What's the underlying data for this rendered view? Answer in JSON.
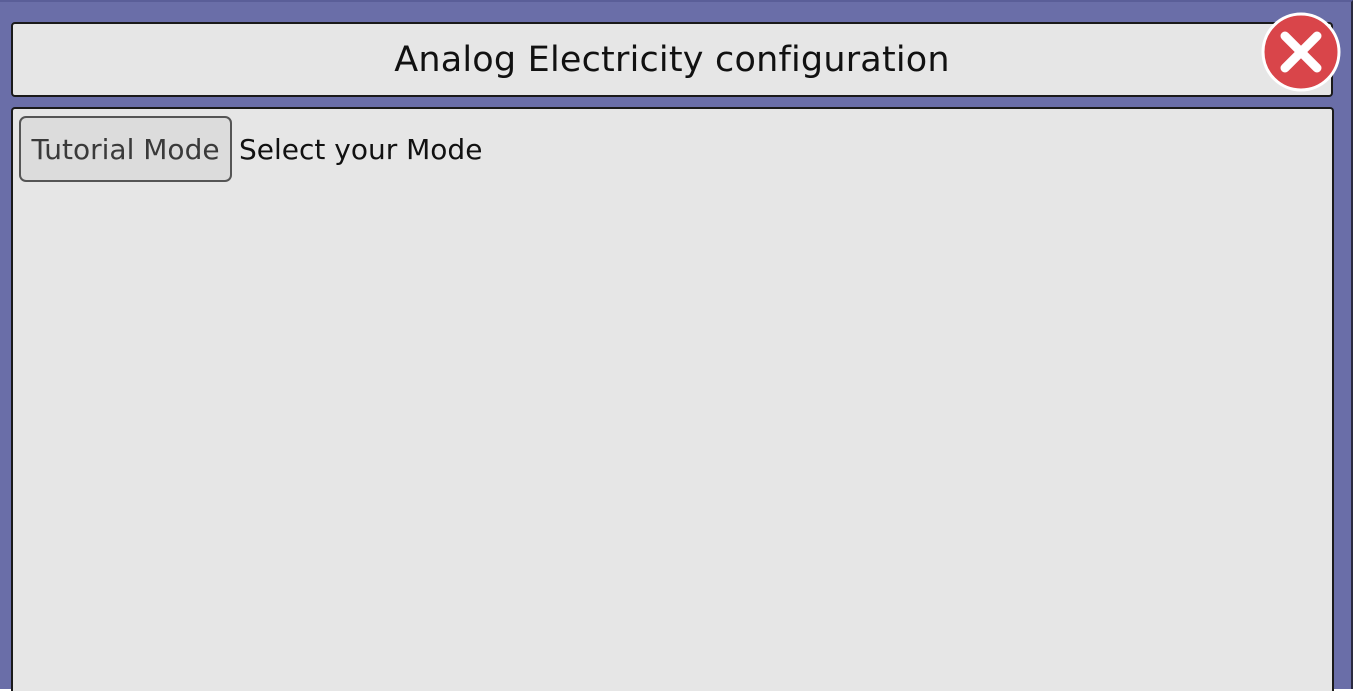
{
  "window": {
    "title": "Analog Electricity configuration"
  },
  "close_button": {
    "icon": "close-icon",
    "color": "#d9454a"
  },
  "mode_selector": {
    "button_label": "Tutorial Mode",
    "prompt": "Select your Mode"
  },
  "colors": {
    "background": "#6a6ea8",
    "panel": "#e6e6e6",
    "button_fill": "#dcdcdc",
    "close_red": "#d9454a"
  }
}
